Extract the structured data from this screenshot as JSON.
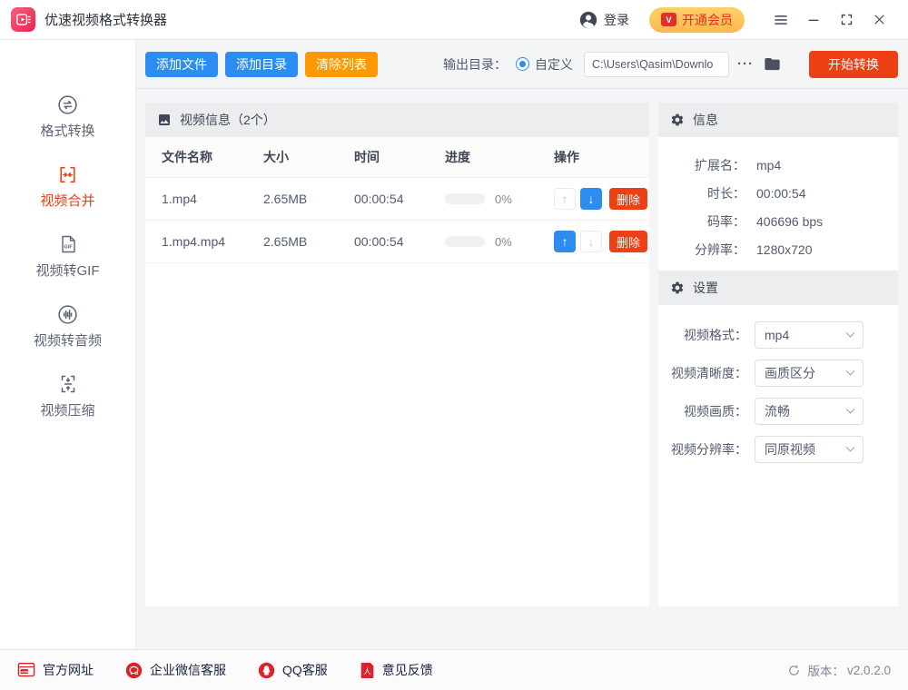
{
  "titlebar": {
    "app_title": "优速视频格式转换器",
    "login_label": "登录",
    "vip_badge": "V",
    "vip_label": "开通会员"
  },
  "toolbar": {
    "add_file_label": "添加文件",
    "add_dir_label": "添加目录",
    "clear_list_label": "清除列表",
    "output_dir_label": "输出目录：",
    "radio_label": "自定义",
    "path_value": "C:\\Users\\Qasim\\Downlo",
    "more_label": "···",
    "start_label": "开始转换"
  },
  "sidebar": {
    "items": [
      {
        "label": "格式转换",
        "active": false
      },
      {
        "label": "视频合并",
        "active": true
      },
      {
        "label": "视频转GIF",
        "active": false
      },
      {
        "label": "视频转音频",
        "active": false
      },
      {
        "label": "视频压缩",
        "active": false
      }
    ]
  },
  "table": {
    "title": "视频信息（2个）",
    "columns": [
      "文件名称",
      "大小",
      "时间",
      "进度",
      "操作"
    ],
    "delete_label": "删除",
    "up_glyph": "↑",
    "down_glyph": "↓",
    "rows": [
      {
        "name": "1.mp4",
        "size": "2.65MB",
        "time": "00:00:54",
        "progress": "0%"
      },
      {
        "name": "1.mp4.mp4",
        "size": "2.65MB",
        "time": "00:00:54",
        "progress": "0%"
      }
    ]
  },
  "info_panel": {
    "title": "信息",
    "rows": [
      {
        "label": "扩展名：",
        "value": "mp4"
      },
      {
        "label": "时长：",
        "value": "00:00:54"
      },
      {
        "label": "码率：",
        "value": "406696 bps"
      },
      {
        "label": "分辨率：",
        "value": "1280x720"
      }
    ]
  },
  "settings_panel": {
    "title": "设置",
    "rows": [
      {
        "label": "视频格式：",
        "value": "mp4"
      },
      {
        "label": "视频清晰度：",
        "value": "画质区分"
      },
      {
        "label": "视频画质：",
        "value": "流畅"
      },
      {
        "label": "视频分辨率：",
        "value": "同原视频"
      }
    ]
  },
  "footer": {
    "links": [
      "官方网址",
      "企业微信客服",
      "QQ客服",
      "意见反馈"
    ],
    "version_label": "版本：",
    "version_value": "v2.0.2.0"
  },
  "colors": {
    "primary_blue": "#2d8cf0",
    "warning_orange": "#ff9900",
    "danger_red": "#ed4014",
    "brand_pink": "#ee2c52",
    "footer_icon_red": "#d9232a",
    "vip_pill_bg": "#fdc255",
    "vip_text_red": "#e12f2b",
    "content_bg": "#f4f5f7",
    "panel_header_bg": "#ebedee"
  }
}
